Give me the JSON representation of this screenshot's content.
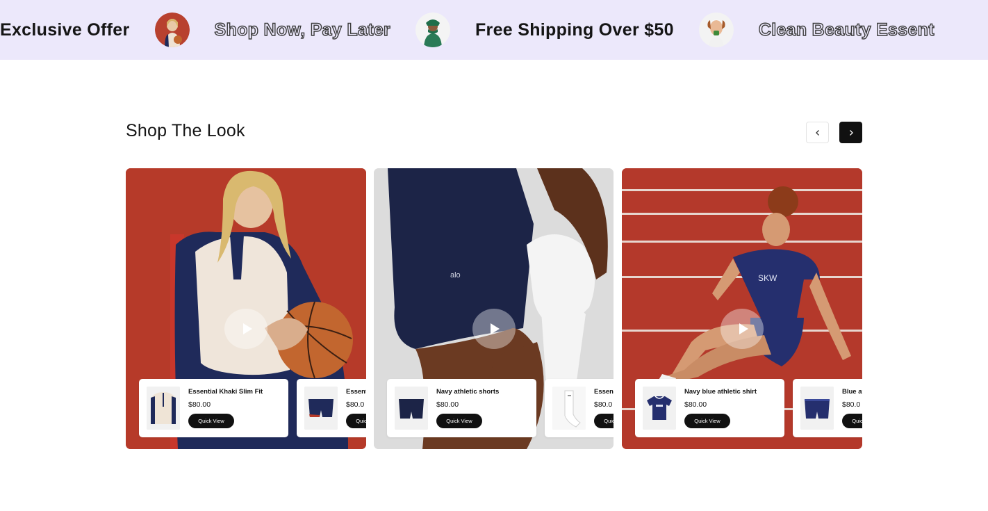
{
  "marquee": {
    "items": [
      {
        "text": "Exclusive Offer",
        "style": "solid"
      },
      {
        "text": "Shop Now, Pay Later",
        "style": "outline"
      },
      {
        "text": "Free Shipping Over $50",
        "style": "solid"
      },
      {
        "text": "Clean Beauty Essent",
        "style": "outline"
      }
    ]
  },
  "section": {
    "title": "Shop The Look",
    "prev_icon": "chevron-left-icon",
    "next_icon": "chevron-right-icon"
  },
  "looks": [
    {
      "play_icon": "play-icon",
      "products": [
        {
          "name": "Essential Khaki Slim Fit",
          "price": "$80.00",
          "button": "Quick View"
        },
        {
          "name": "Essent",
          "price": "$80.0",
          "button": "Quick View"
        }
      ]
    },
    {
      "play_icon": "play-icon",
      "products": [
        {
          "name": "Navy athletic shorts",
          "price": "$80.00",
          "button": "Quick View"
        },
        {
          "name": "Essent",
          "price": "$80.0",
          "button": "Quick View"
        }
      ]
    },
    {
      "play_icon": "play-icon",
      "products": [
        {
          "name": "Navy blue athletic shirt",
          "price": "$80.00",
          "button": "Quick View"
        },
        {
          "name": "Blue at",
          "price": "$80.0",
          "button": "Quick View"
        }
      ]
    }
  ],
  "colors": {
    "marquee_bg": "#ece8fb",
    "accent_dark": "#111111",
    "card_red": "#b63a29",
    "card_grey": "#dcdcdc",
    "navy": "#1f2a5a"
  }
}
